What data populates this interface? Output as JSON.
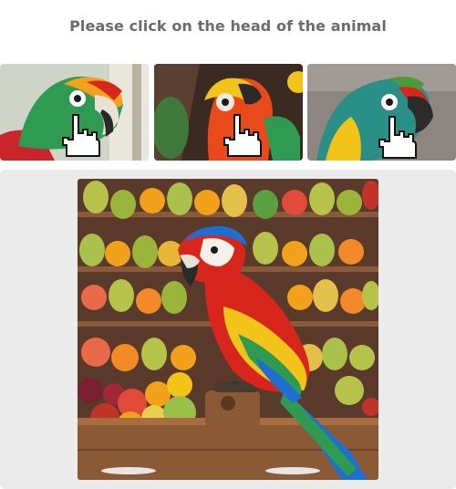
{
  "captcha": {
    "prompt": "Please click on the head of the animal"
  },
  "examples": [
    {
      "subject": "parrot",
      "marker": "hand-pointer-icon"
    },
    {
      "subject": "parrot",
      "marker": "hand-pointer-icon"
    },
    {
      "subject": "parrot",
      "marker": "hand-pointer-icon"
    }
  ],
  "challenge": {
    "subject": "parrot",
    "scene": "fruit"
  },
  "colors": {
    "prompt_text": "#6b6b6b",
    "panel_bg": "#ebebeb",
    "parrot_red": "#d9261c",
    "parrot_blue": "#1f6fd1",
    "parrot_yellow": "#f2c318",
    "parrot_green": "#2f9a52"
  }
}
